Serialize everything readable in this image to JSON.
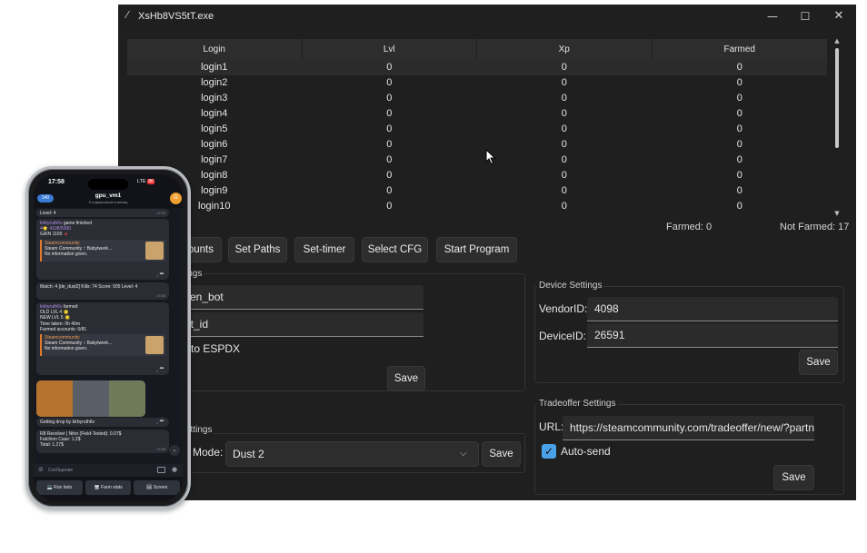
{
  "window": {
    "title": "XsHb8VS5tT.exe",
    "controls": {
      "minimize": "—",
      "maximize": "☐",
      "close": "✕"
    }
  },
  "table": {
    "headers": [
      "Login",
      "Lvl",
      "Xp",
      "Farmed"
    ],
    "rows": [
      [
        "login1",
        "0",
        "0",
        "0"
      ],
      [
        "login2",
        "0",
        "0",
        "0"
      ],
      [
        "login3",
        "0",
        "0",
        "0"
      ],
      [
        "login4",
        "0",
        "0",
        "0"
      ],
      [
        "login5",
        "0",
        "0",
        "0"
      ],
      [
        "login6",
        "0",
        "0",
        "0"
      ],
      [
        "login7",
        "0",
        "0",
        "0"
      ],
      [
        "login8",
        "0",
        "0",
        "0"
      ],
      [
        "login9",
        "0",
        "0",
        "0"
      ],
      [
        "login10",
        "0",
        "0",
        "0"
      ]
    ]
  },
  "summary": {
    "farmed": "Farmed: 0",
    "not_farmed": "Not Farmed: 17"
  },
  "toolbar": {
    "accounts": "ounts",
    "set_paths": "Set Paths",
    "set_timer": "Set-timer",
    "select_cfg": "Select CFG",
    "start_program": "Start Program"
  },
  "tg_settings": {
    "title": "ings",
    "token_value": "ken_bot",
    "chat_value": "at_id",
    "checkbox_label": "to ESPDX",
    "save": "Save"
  },
  "mode_settings": {
    "title": "ettings",
    "label": "Mode:",
    "value": "Dust 2",
    "save": "Save"
  },
  "device_settings": {
    "title": "Device Settings",
    "vendor_label": "VendorID:",
    "vendor_value": "4098",
    "device_label": "DeviceID:",
    "device_value": "26591",
    "save": "Save"
  },
  "tradeoffer_settings": {
    "title": "Tradeoffer Settings",
    "url_label": "URL:",
    "url_value": "https://steamcommunity.com/tradeoffer/new/?partn",
    "auto_send_label": "Auto-send",
    "auto_send_checked": true,
    "save": "Save"
  },
  "phone": {
    "time": "17:58",
    "signal": "LTE",
    "battery": "86",
    "back_count": "140",
    "chat_name": "gpu_vm1",
    "chat_subtitle": "5 подписчиков в месяц",
    "messages": {
      "m0": "Level: 4",
      "m0_time": "17:52",
      "m1_user": "kirbyruth6v",
      "m1_text": " game finished",
      "m1_l2": "4⭐ 4108/5000",
      "m1_l3": "GAIN 1100 🔺",
      "m1_card1": "Steamcommunity",
      "m1_card2": "Steam Community :: Babytwerk...",
      "m1_card3": "No information given.",
      "m1_time": "17:53",
      "m2_text": "Match: 4 [de_dust2] Kills: 74 Score: 905 Level: 4",
      "m2_time": "17:53",
      "m3_user": "kirbyruth6v",
      "m3_text": " farmed",
      "m3_l2": "OLD LVL 4 🌟",
      "m3_l3": "NEW LVL 5 🌟",
      "m3_l4": "Time taken: 0h 40m",
      "m3_l5": "Farmed accounts: 6/81",
      "m3_card1": "Steamcommunity",
      "m3_card2": "Steam Community :: Babytwerk...",
      "m3_card3": "No information given.",
      "m3_time": "17:53",
      "m4_text": "Getting drop by kirbyruth6v",
      "m4_time": "17:56",
      "m5_l1": "R8 Revolver | Nitro (Field-Tested): 0.07$",
      "m5_l2": "Falchion Case: 1.2$",
      "m5_l3": "Total: 1.27$",
      "m5_time": "17:56"
    },
    "input_placeholder": "Сообщение",
    "keyboard": [
      "💻 Run bots",
      "🖥 Farm stats",
      "🖼 Screen"
    ]
  }
}
